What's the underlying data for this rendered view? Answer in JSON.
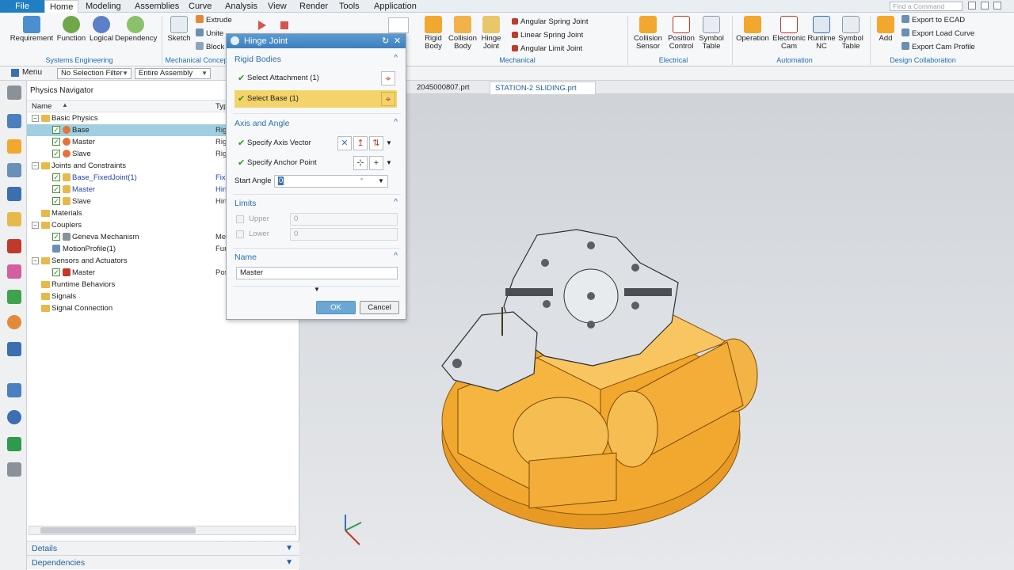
{
  "menubar": {
    "tabs": [
      "File",
      "Home",
      "Modeling",
      "Assemblies",
      "Curve",
      "Analysis",
      "View",
      "Render",
      "Tools",
      "Application"
    ],
    "find_placeholder": "Find a Command"
  },
  "ribbon": {
    "systems_engineering": {
      "label": "Systems Engineering",
      "buttons": [
        "Requirement",
        "Function",
        "Logical",
        "Dependency"
      ]
    },
    "mechanical_concept": {
      "label": "Mechanical Concep",
      "buttons": [
        "Sketch"
      ],
      "small": [
        "Extrude",
        "Unite",
        "Block"
      ]
    },
    "mechanical": {
      "label": "Mechanical",
      "buttons": [
        "Rigid Body",
        "Collision Body",
        "Hinge Joint"
      ],
      "small": [
        "Angular Spring Joint",
        "Linear Spring Joint",
        "Angular Limit Joint"
      ]
    },
    "electrical": {
      "label": "Electrical",
      "buttons": [
        "Collision Sensor",
        "Position Control",
        "Symbol Table"
      ]
    },
    "automation": {
      "label": "Automation",
      "buttons": [
        "Operation",
        "Electronic Cam",
        "Runtime NC",
        "Symbol Table"
      ]
    },
    "design_collaboration": {
      "label": "Design Collaboration",
      "buttons": [
        "Add"
      ],
      "small": [
        "Export to ECAD",
        "Export Load Curve",
        "Export Cam Profile"
      ]
    }
  },
  "toolbar2": {
    "menu": "Menu",
    "selection_filter": "No Selection Filter",
    "scope": "Entire Assembly"
  },
  "doc_tabs": [
    "2045000807.prt",
    "STATION-2 SLIDING.prt"
  ],
  "navigator": {
    "title": "Physics Navigator",
    "col_name": "Name",
    "col_type": "Typ",
    "rows": [
      {
        "label": "Basic Physics",
        "type": ""
      },
      {
        "label": "Base",
        "type": "Rig"
      },
      {
        "label": "Master",
        "type": "Rig"
      },
      {
        "label": "Slave",
        "type": "Rig"
      },
      {
        "label": "Joints and Constraints",
        "type": ""
      },
      {
        "label": "Base_FixedJoint(1)",
        "type": "Fixe"
      },
      {
        "label": "Master",
        "type": "Hin"
      },
      {
        "label": "Slave",
        "type": "Hin"
      },
      {
        "label": "Materials",
        "type": ""
      },
      {
        "label": "Couplers",
        "type": ""
      },
      {
        "label": "Geneva Mechanism",
        "type": "Me"
      },
      {
        "label": "MotionProfile(1)",
        "type": "Fur"
      },
      {
        "label": "Sensors and Actuators",
        "type": ""
      },
      {
        "label": "Master",
        "type": "Pos"
      },
      {
        "label": "Runtime Behaviors",
        "type": ""
      },
      {
        "label": "Signals",
        "type": ""
      },
      {
        "label": "Signal Connection",
        "type": ""
      }
    ],
    "footer_details": "Details",
    "footer_dependencies": "Dependencies"
  },
  "dialog": {
    "title": "Hinge Joint",
    "rigid_bodies": "Rigid Bodies",
    "select_attachment": "Select Attachment (1)",
    "select_base": "Select Base (1)",
    "axis_and_angle": "Axis and Angle",
    "specify_axis_vector": "Specify Axis Vector",
    "specify_anchor_point": "Specify Anchor Point",
    "start_angle_label": "Start Angle",
    "start_angle_value": "0",
    "limits": "Limits",
    "upper_label": "Upper",
    "upper_value": "0",
    "lower_label": "Lower",
    "lower_value": "0",
    "name_section": "Name",
    "name_value": "Master",
    "ok": "OK",
    "cancel": "Cancel"
  },
  "colors": {
    "accent": "#1f7fc2",
    "highlight": "#f3d36a",
    "model_orange": "#f2a72e"
  }
}
